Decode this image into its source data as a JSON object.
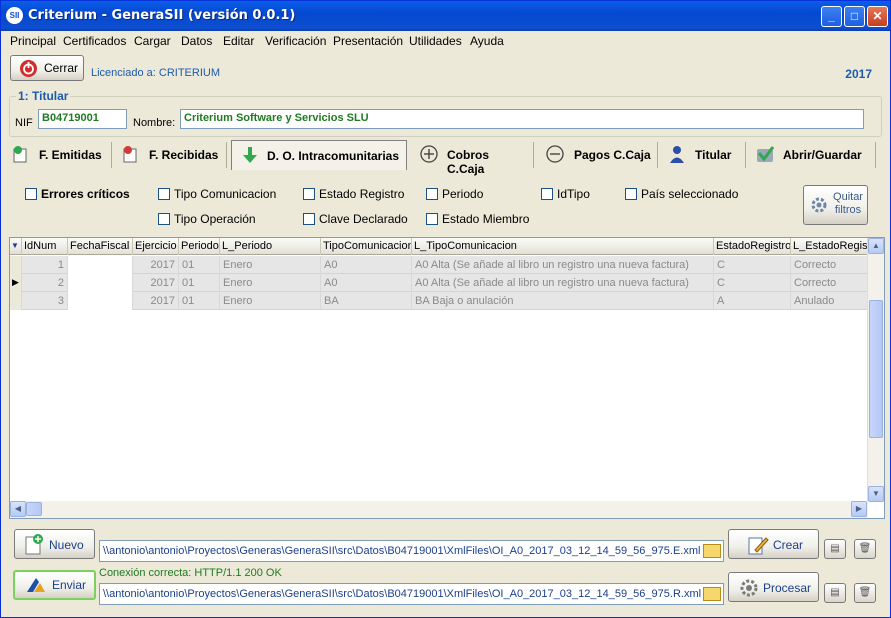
{
  "window": {
    "title": "Criterium - GeneraSII (versión 0.0.1)",
    "minimize": "_",
    "maximize": "□",
    "close": "✕"
  },
  "menu": [
    "Principal",
    "Certificados",
    "Cargar",
    "Datos",
    "Editar",
    "Verificación",
    "Presentación",
    "Utilidades",
    "Ayuda"
  ],
  "toolbar": {
    "close_label": "Cerrar",
    "license": "Licenciado a: CRITERIUM",
    "year": "2017"
  },
  "titular": {
    "legend": "1: Titular",
    "nif_label": "NIF",
    "nif_value": "B04719001",
    "nombre_label": "Nombre:",
    "nombre_value": "Criterium Software y Servicios SLU"
  },
  "tabs": [
    {
      "label": "F. Emitidas",
      "icon": "upload-icon"
    },
    {
      "label": "F. Recibidas",
      "icon": "download-icon"
    },
    {
      "label": "D. O. Intracomunitarias",
      "icon": "down-arrow-icon"
    },
    {
      "label": "Cobros C.Caja",
      "icon": "plus-circle-icon"
    },
    {
      "label": "Pagos C.Caja",
      "icon": "minus-circle-icon"
    },
    {
      "label": "Titular",
      "icon": "user-icon"
    },
    {
      "label": "Abrir/Guardar",
      "icon": "check-icon"
    }
  ],
  "filters": {
    "errores": "Errores críticos",
    "tipo_comunicacion": "Tipo Comunicacion",
    "estado_registro": "Estado Registro",
    "periodo": "Periodo",
    "idtipo": "IdTipo",
    "pais": "País seleccionado",
    "tipo_operacion": "Tipo Operación",
    "clave_declarado": "Clave Declarado",
    "estado_miembro": "Estado Miembro",
    "quitar": "Quitar filtros"
  },
  "grid": {
    "columns": [
      "IdNum",
      "FechaFiscal",
      "Ejercicio",
      "Periodo",
      "L_Periodo",
      "TipoComunicacion",
      "L_TipoComunicacion",
      "EstadoRegistro",
      "L_EstadoRegist"
    ],
    "rows": [
      [
        "1",
        "",
        "2017",
        "01",
        "Enero",
        "A0",
        "A0 Alta (Se añade al libro un registro una nueva factura)",
        "C",
        "Correcto"
      ],
      [
        "2",
        "",
        "2017",
        "01",
        "Enero",
        "A0",
        "A0 Alta (Se añade al libro un registro una nueva factura)",
        "C",
        "Correcto"
      ],
      [
        "3",
        "",
        "2017",
        "01",
        "Enero",
        "BA",
        "BA Baja o anulación",
        "A",
        "Anulado"
      ]
    ],
    "current_row": 1
  },
  "bottom": {
    "nuevo_label": "Nuevo",
    "path1": "\\\\antonio\\antonio\\Proyectos\\Generas\\GeneraSII\\src\\Datos\\B04719001\\XmlFiles\\OI_A0_2017_03_12_14_59_56_975.E.xml",
    "crear_label": "Crear",
    "enviar_label": "Enviar",
    "status": "Conexión correcta: HTTP/1.1 200 OK",
    "path2": "\\\\antonio\\antonio\\Proyectos\\Generas\\GeneraSII\\src\\Datos\\B04719001\\XmlFiles\\OI_A0_2017_03_12_14_59_56_975.R.xml",
    "procesar_label": "Procesar"
  }
}
